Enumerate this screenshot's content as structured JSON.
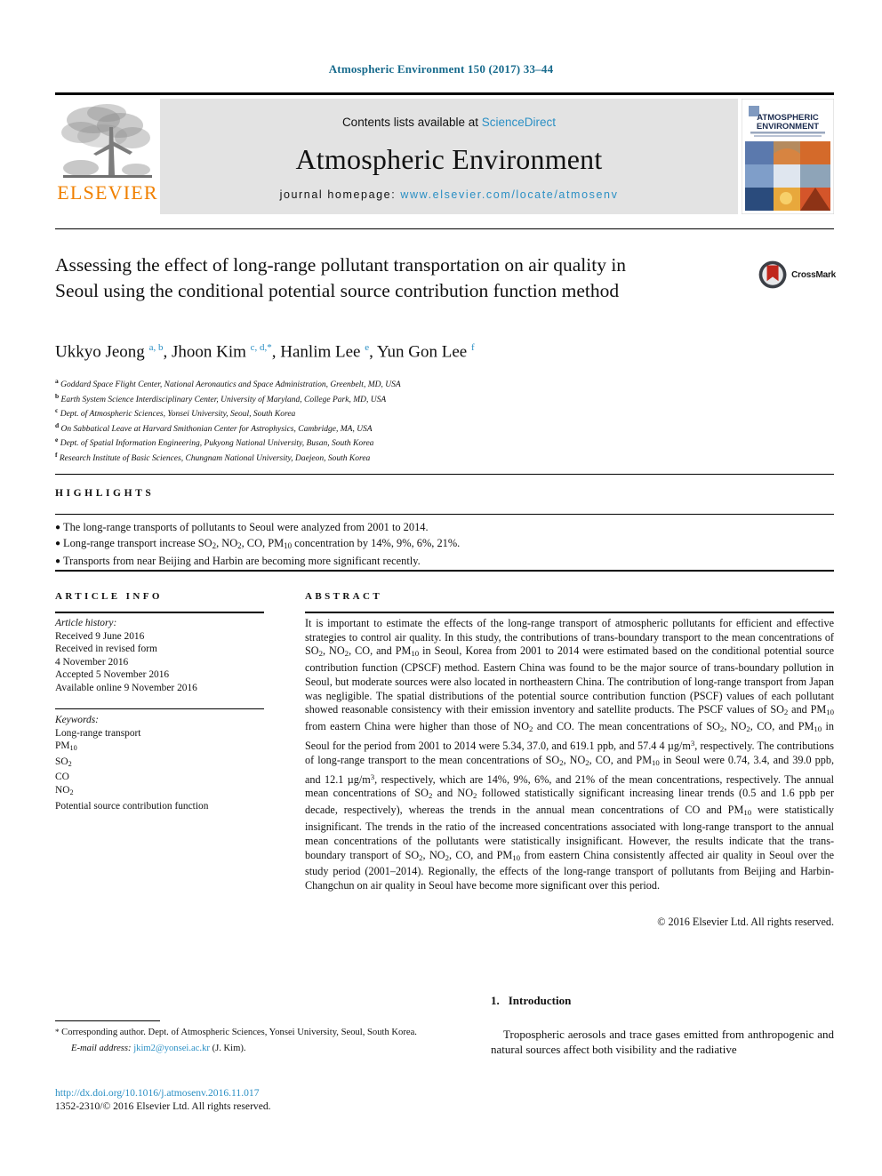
{
  "running_head": "Atmospheric Environment 150 (2017) 33–44",
  "masthead": {
    "publisher": "ELSEVIER",
    "contents_prefix": "Contents lists available at ",
    "contents_link": "ScienceDirect",
    "journal_name": "Atmospheric Environment",
    "homepage_prefix": "journal homepage: ",
    "homepage_url": "www.elsevier.com/locate/atmosenv",
    "cover_title_line1": "ATMOSPHERIC",
    "cover_title_line2": "ENVIRONMENT"
  },
  "article": {
    "title": "Assessing the effect of long-range pollutant transportation on air quality in Seoul using the conditional potential source contribution function method",
    "crossmark_label": "CrossMark",
    "authors_html": "Ukkyo Jeong <sup>a, b</sup>, Jhoon Kim <sup>c, d,</sup><sup class=\"star\">*</sup>, Hanlim Lee <sup>e</sup>, Yun Gon Lee <sup>f</sup>",
    "affiliations": [
      {
        "marker": "a",
        "text": "Goddard Space Flight Center, National Aeronautics and Space Administration, Greenbelt, MD, USA"
      },
      {
        "marker": "b",
        "text": "Earth System Science Interdisciplinary Center, University of Maryland, College Park, MD, USA"
      },
      {
        "marker": "c",
        "text": "Dept. of Atmospheric Sciences, Yonsei University, Seoul, South Korea"
      },
      {
        "marker": "d",
        "text": "On Sabbatical Leave at Harvard Smithonian Center for Astrophysics, Cambridge, MA, USA"
      },
      {
        "marker": "e",
        "text": "Dept. of Spatial Information Engineering, Pukyong National University, Busan, South Korea"
      },
      {
        "marker": "f",
        "text": "Research Institute of Basic Sciences, Chungnam National University, Daejeon, South Korea"
      }
    ]
  },
  "highlights": {
    "heading": "HIGHLIGHTS",
    "items_html": [
      "The long-range transports of pollutants to Seoul were analyzed from 2001 to 2014.",
      "Long-range transport increase SO<sub>2</sub>, NO<sub>2</sub>, CO, PM<sub>10</sub> concentration by 14%, 9%, 6%, 21%.",
      "Transports from near Beijing and Harbin are becoming more significant recently."
    ]
  },
  "article_info": {
    "heading": "ARTICLE INFO",
    "history_label": "Article history:",
    "history_lines": [
      "Received 9 June 2016",
      "Received in revised form",
      "4 November 2016",
      "Accepted 5 November 2016",
      "Available online 9 November 2016"
    ],
    "keywords_label": "Keywords:",
    "keywords_html": [
      "Long-range transport",
      "PM<sub>10</sub>",
      "SO<sub>2</sub>",
      "CO",
      "NO<sub>2</sub>",
      "Potential source contribution function"
    ]
  },
  "abstract": {
    "heading": "ABSTRACT",
    "body_html": "It is important to estimate the effects of the long-range transport of atmospheric pollutants for efficient and effective strategies to control air quality. In this study, the contributions of trans-boundary transport to the mean concentrations of SO<sub>2</sub>, NO<sub>2</sub>, CO, and PM<sub>10</sub> in Seoul, Korea from 2001 to 2014 were estimated based on the conditional potential source contribution function (CPSCF) method. Eastern China was found to be the major source of trans-boundary pollution in Seoul, but moderate sources were also located in northeastern China. The contribution of long-range transport from Japan was negligible. The spatial distributions of the potential source contribution function (PSCF) values of each pollutant showed reasonable consistency with their emission inventory and satellite products. The PSCF values of SO<sub>2</sub> and PM<sub>10</sub> from eastern China were higher than those of NO<sub>2</sub> and CO. The mean concentrations of SO<sub>2</sub>, NO<sub>2</sub>, CO, and PM<sub>10</sub> in Seoul for the period from 2001 to 2014 were 5.34, 37.0, and 619.1 ppb, and 57.4 4 µg/m<sup class=\"num\">3</sup>, respectively. The contributions of long-range transport to the mean concentrations of SO<sub>2</sub>, NO<sub>2</sub>, CO, and PM<sub>10</sub> in Seoul were 0.74, 3.4, and 39.0 ppb, and 12.1 µg/m<sup class=\"num\">3</sup>, respectively, which are 14%, 9%, 6%, and 21% of the mean concentrations, respectively. The annual mean concentrations of SO<sub>2</sub> and NO<sub>2</sub> followed statistically significant increasing linear trends (0.5 and 1.6 ppb per decade, respectively), whereas the trends in the annual mean concentrations of CO and PM<sub>10</sub> were statistically insignificant. The trends in the ratio of the increased concentrations associated with long-range transport to the annual mean concentrations of the pollutants were statistically insignificant. However, the results indicate that the trans-boundary transport of SO<sub>2</sub>, NO<sub>2</sub>, CO, and PM<sub>10</sub> from eastern China consistently affected air quality in Seoul over the study period (2001–2014). Regionally, the effects of the long-range transport of pollutants from Beijing and Harbin-Changchun on air quality in Seoul have become more significant over this period.",
    "copyright": "© 2016 Elsevier Ltd. All rights reserved."
  },
  "footer": {
    "corresponding_note": "Corresponding author. Dept. of Atmospheric Sciences, Yonsei University, Seoul, South Korea.",
    "email_label": "E-mail address:",
    "email": "jkim2@yonsei.ac.kr",
    "email_suffix": "(J. Kim).",
    "doi": "http://dx.doi.org/10.1016/j.atmosenv.2016.11.017",
    "issn_line": "1352-2310/© 2016 Elsevier Ltd. All rights reserved."
  },
  "introduction": {
    "number": "1.",
    "heading": "Introduction",
    "paragraph": "Tropospheric aerosols and trace gases emitted from anthropogenic and natural sources affect both visibility and the radiative"
  }
}
